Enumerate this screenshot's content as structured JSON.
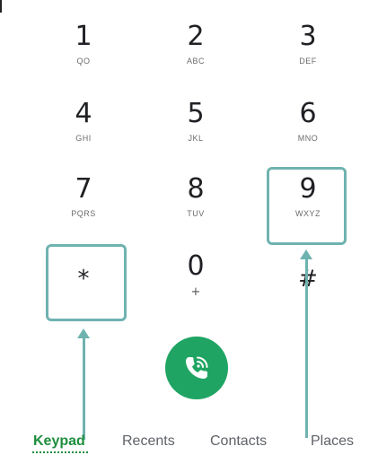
{
  "keypad": {
    "keys": [
      {
        "digit": "1",
        "letters": "QO"
      },
      {
        "digit": "2",
        "letters": "ABC"
      },
      {
        "digit": "3",
        "letters": "DEF"
      },
      {
        "digit": "4",
        "letters": "GHI"
      },
      {
        "digit": "5",
        "letters": "JKL"
      },
      {
        "digit": "6",
        "letters": "MNO"
      },
      {
        "digit": "7",
        "letters": "PQRS"
      },
      {
        "digit": "8",
        "letters": "TUV"
      },
      {
        "digit": "9",
        "letters": "WXYZ"
      },
      {
        "digit": "*",
        "letters": ""
      },
      {
        "digit": "0",
        "letters": "+"
      },
      {
        "digit": "#",
        "letters": ""
      }
    ]
  },
  "call_button": {
    "icon": "phone-wifi-call-icon",
    "color": "#1fa463"
  },
  "annotation_color": "#6fb3b0",
  "tabs": {
    "keypad": "Keypad",
    "recents": "Recents",
    "contacts": "Contacts",
    "places": "Places"
  },
  "active_tab": "Keypad",
  "accent_color": "#1e8e3e"
}
